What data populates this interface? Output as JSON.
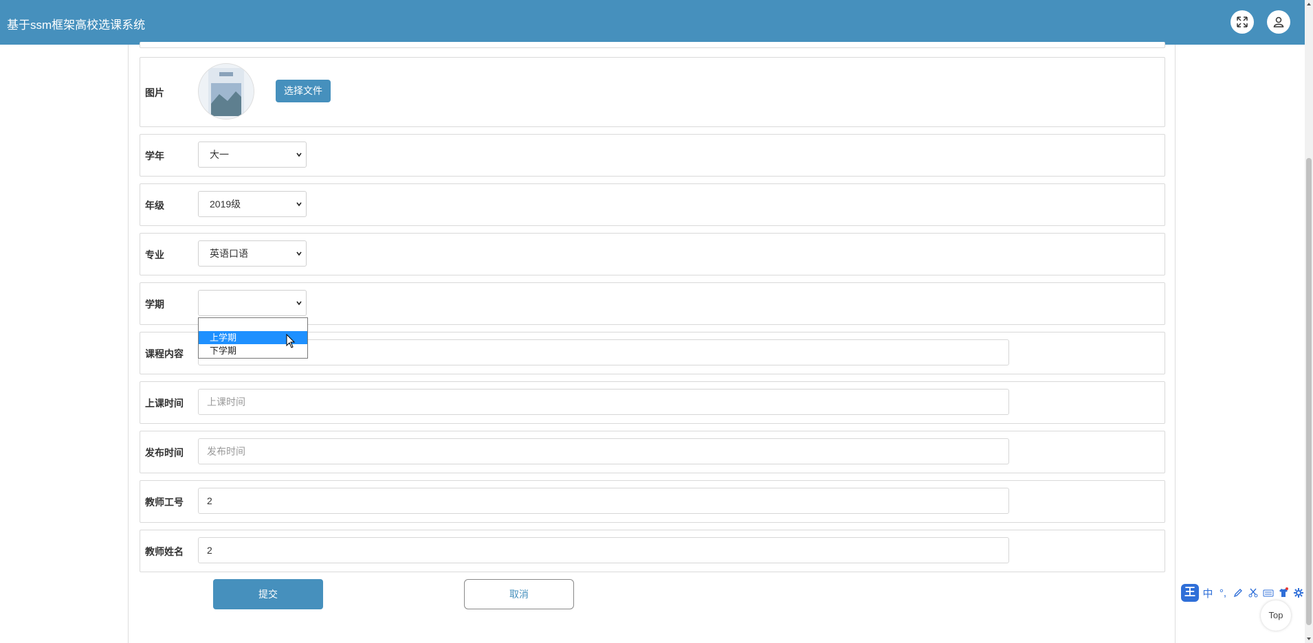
{
  "header": {
    "title": "基于ssm框架高校选课系统",
    "fullscreen_icon": "fullscreen-icon",
    "user_icon": "user-icon"
  },
  "form": {
    "image": {
      "label": "图片",
      "choose_label": "选择文件"
    },
    "academic_year": {
      "label": "学年",
      "value": "大一"
    },
    "grade": {
      "label": "年级",
      "value": "2019级"
    },
    "major": {
      "label": "专业",
      "value": "英语口语"
    },
    "semester": {
      "label": "学期",
      "value": "",
      "options": [
        "",
        "上学期",
        "下学期"
      ],
      "highlighted": "上学期"
    },
    "course_content": {
      "label": "课程内容",
      "value": ""
    },
    "class_time": {
      "label": "上课时间",
      "placeholder": "上课时间",
      "value": ""
    },
    "publish_time": {
      "label": "发布时间",
      "placeholder": "发布时间",
      "value": ""
    },
    "teacher_id": {
      "label": "教师工号",
      "value": "2"
    },
    "teacher_name": {
      "label": "教师姓名",
      "value": "2"
    },
    "submit_label": "提交",
    "cancel_label": "取消"
  },
  "ime_toolbar": {
    "logo": "王",
    "items": [
      "中",
      "°,",
      "pen-icon",
      "scissors-icon",
      "keyboard-icon",
      "shirt-icon",
      "gear-icon"
    ]
  },
  "top_button": {
    "label": "Top"
  },
  "colors": {
    "primary": "#4690bd",
    "dropdown_highlight": "#1e90ff"
  }
}
